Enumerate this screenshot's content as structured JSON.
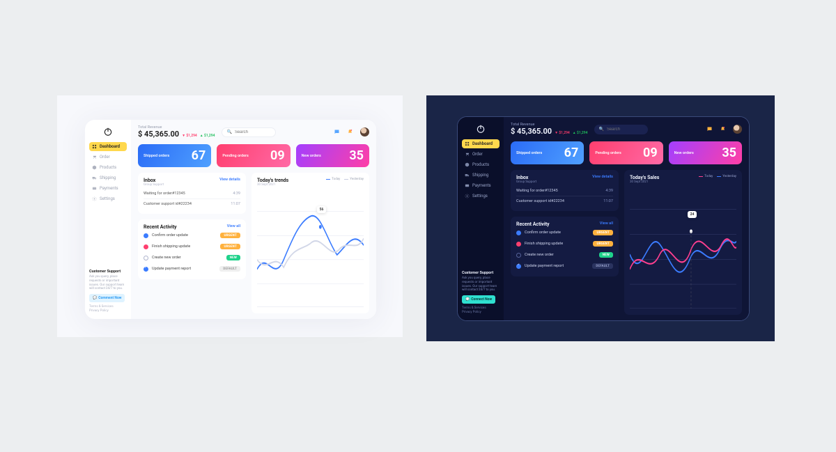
{
  "revenue": {
    "label": "Total Revenue",
    "value": "$ 45,365.00",
    "change_down": "$1,294",
    "change_up": "$1,294"
  },
  "search": {
    "placeholder": "Search"
  },
  "sidebar": {
    "items": [
      {
        "icon": "grid",
        "label": "Dashboard",
        "active": true
      },
      {
        "icon": "cart",
        "label": "Order"
      },
      {
        "icon": "box",
        "label": "Products"
      },
      {
        "icon": "truck",
        "label": "Shipping"
      },
      {
        "icon": "card",
        "label": "Payments"
      },
      {
        "icon": "gear",
        "label": "Settings"
      }
    ]
  },
  "support": {
    "title": "Customer Support",
    "text_light": "Ask you query, place requests or important issues. Our support team will contact 24/7 to you.",
    "text_dark": "Ask you query, place requests or important issues. Our support team will contact 24/7 to you.",
    "button_light": "Comment Now",
    "button_dark": "Connect Now",
    "footer1": "Terms & Services",
    "footer2": "Privacy Policy"
  },
  "stats": [
    {
      "title": "Shipped orders",
      "value": "67"
    },
    {
      "title": "Pending orders",
      "value": "09"
    },
    {
      "title": "New orders",
      "value": "35"
    }
  ],
  "inbox": {
    "title": "Inbox",
    "subtitle": "Group Support",
    "view": "View details",
    "rows": [
      {
        "label": "Waiting for order#12345",
        "val": "4:39"
      },
      {
        "label": "Customer support id#22234",
        "val": "11:07"
      }
    ]
  },
  "activity": {
    "title": "Recent Activity",
    "view": "View all",
    "rows": [
      {
        "dot": "blue",
        "label": "Confirm order update",
        "badge": "URGENT",
        "badge_cls": "b-urg"
      },
      {
        "dot": "red",
        "label": "Finish shipping update",
        "badge": "URGENT",
        "badge_cls": "b-urg"
      },
      {
        "dot": "empty",
        "label": "Create new order",
        "badge": "NEW",
        "badge_cls": "b-new"
      },
      {
        "dot": "check",
        "label": "Update payment report",
        "badge": "DEFAULT",
        "badge_cls": "b-def"
      }
    ]
  },
  "trends": {
    "title_light": "Today's trends",
    "title_dark": "Today's Sales",
    "date": "30 Sept 2021",
    "legend_today": "Today",
    "legend_yesterday": "Yesterday",
    "tooltip_light": "56",
    "tooltip_dark": "24"
  },
  "chart_data": {
    "type": "line",
    "x": [
      0,
      1,
      2,
      3,
      4,
      5,
      6,
      7,
      8,
      9,
      10,
      11
    ],
    "ylim": [
      0,
      70
    ],
    "series": [
      {
        "name": "Today",
        "values": [
          20,
          28,
          18,
          40,
          52,
          56,
          48,
          30,
          38,
          50,
          42,
          30
        ]
      },
      {
        "name": "Yesterday",
        "values": [
          30,
          22,
          34,
          26,
          40,
          44,
          36,
          48,
          32,
          40,
          46,
          38
        ]
      }
    ]
  }
}
